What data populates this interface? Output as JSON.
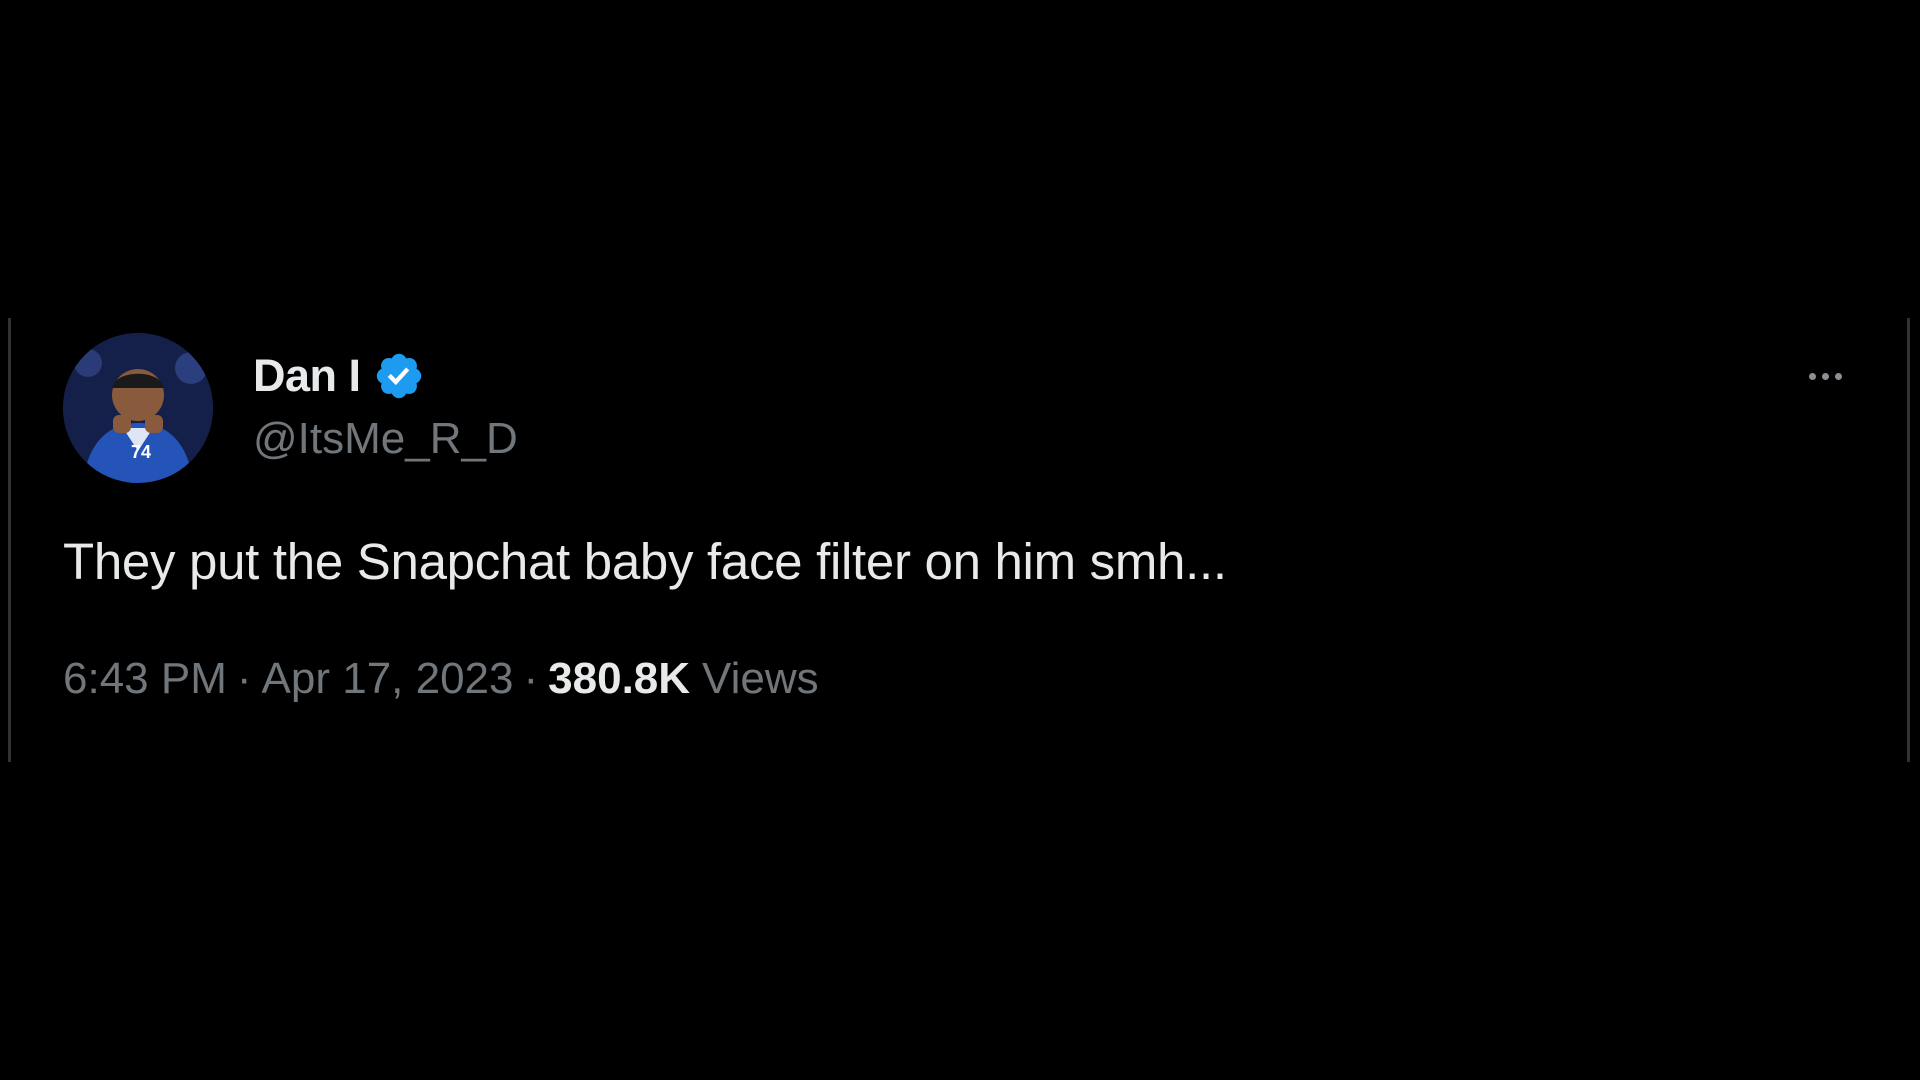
{
  "tweet": {
    "author": {
      "display_name": "Dan I",
      "handle": "@ItsMe_R_D",
      "verified": true,
      "verified_icon": "verified-badge-icon",
      "verified_color": "#1d9bf0"
    },
    "text": "They put the Snapchat baby face filter on him smh...",
    "time": "6:43 PM",
    "separator": "·",
    "date": "Apr 17, 2023",
    "views_count": "380.8K",
    "views_label": "Views",
    "more_icon": "more-horizontal-icon"
  },
  "colors": {
    "background": "#000000",
    "primary_text": "#e7e9ea",
    "secondary_text": "#71767b",
    "border": "#2f3336"
  }
}
